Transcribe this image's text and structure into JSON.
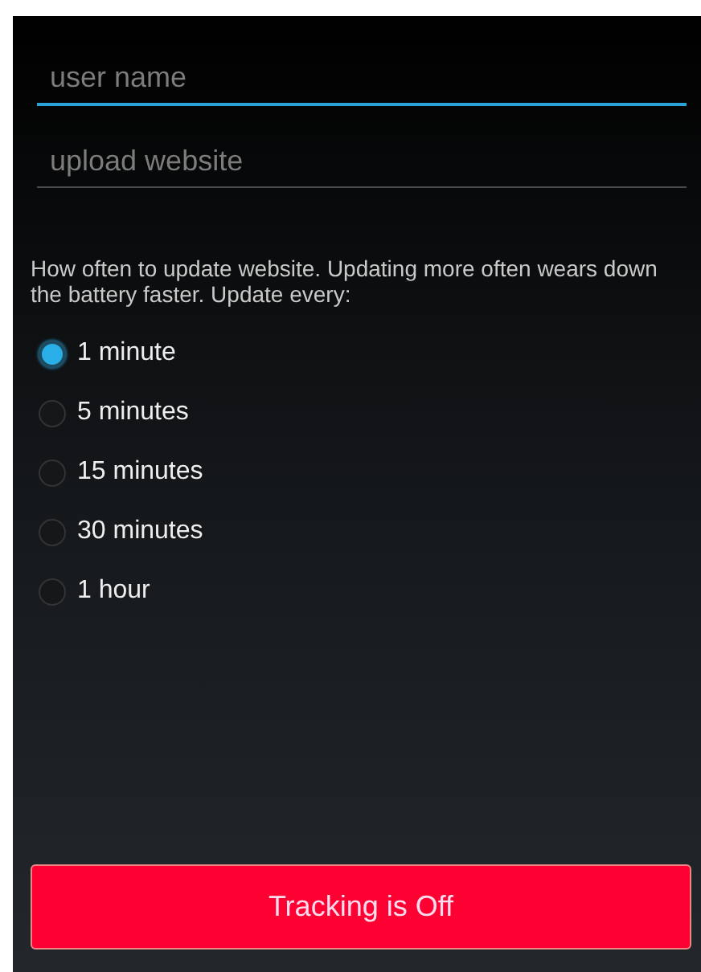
{
  "fields": [
    {
      "placeholder": "user name",
      "focused": true
    },
    {
      "placeholder": "upload website",
      "focused": false
    }
  ],
  "description": "How often to update website. Updating more often wears down the battery faster. Update every:",
  "intervals": [
    {
      "label": "1 minute",
      "selected": true
    },
    {
      "label": "5 minutes",
      "selected": false
    },
    {
      "label": "15 minutes",
      "selected": false
    },
    {
      "label": "30 minutes",
      "selected": false
    },
    {
      "label": "1 hour",
      "selected": false
    }
  ],
  "tracking_button": {
    "label": "Tracking is Off"
  }
}
